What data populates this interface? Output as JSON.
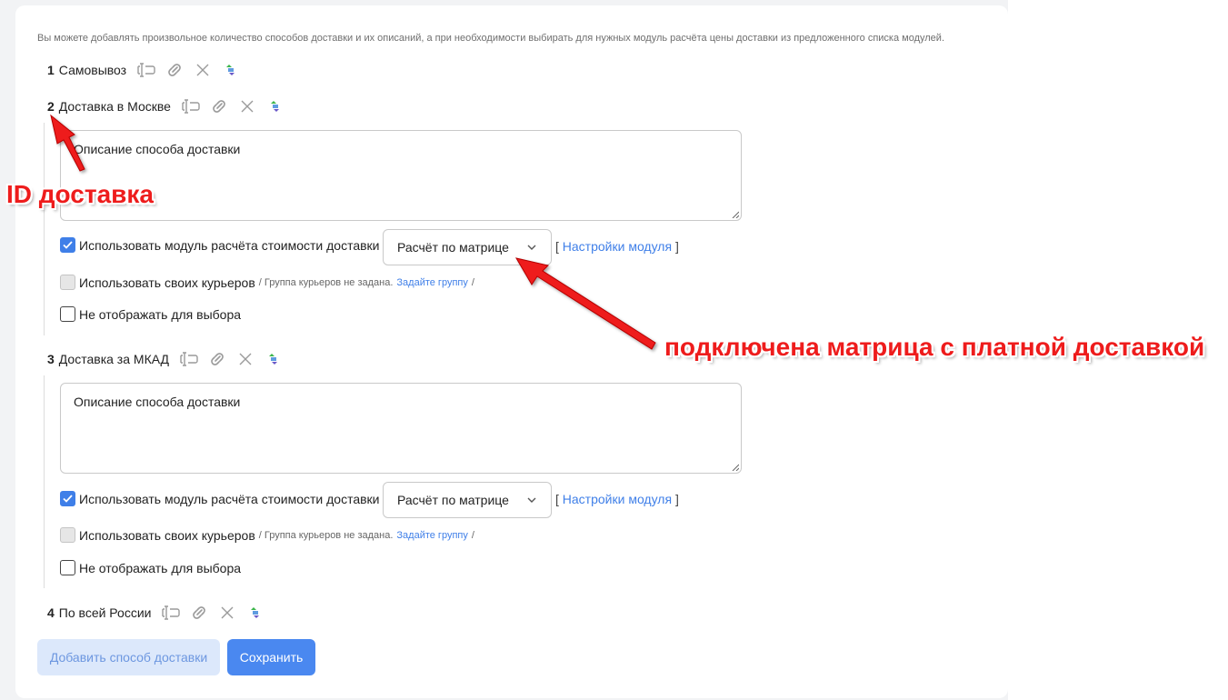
{
  "intro": "Вы можете добавлять произвольное количество способов доставки и их описаний, а при необходимости выбирать для нужных модуль расчёта цены доставки из предложенного списка модулей.",
  "methods": [
    {
      "num": "1",
      "title": "Самовывоз"
    },
    {
      "num": "2",
      "title": "Доставка в Москве",
      "description": "Описание способа доставки",
      "use_module_label": "Использовать модуль расчёта стоимости доставки",
      "use_module_checked": true,
      "module_selected": "Расчёт по матрице",
      "module_settings_open": "[",
      "module_settings_link": "Настройки модуля",
      "module_settings_close": "]",
      "couriers_label": "Использовать своих курьеров",
      "couriers_note": "/ Группа курьеров не задана.",
      "couriers_link": "Задайте группу",
      "couriers_note_end": "/",
      "hide_label": "Не отображать для выбора"
    },
    {
      "num": "3",
      "title": "Доставка за МКАД",
      "description": "Описание способа доставки",
      "use_module_label": "Использовать модуль расчёта стоимости доставки",
      "use_module_checked": true,
      "module_selected": "Расчёт по матрице",
      "module_settings_open": "[",
      "module_settings_link": "Настройки модуля",
      "module_settings_close": "]",
      "couriers_label": "Использовать своих курьеров",
      "couriers_note": "/ Группа курьеров не задана.",
      "couriers_link": "Задайте группу",
      "couriers_note_end": "/",
      "hide_label": "Не отображать для выбора"
    },
    {
      "num": "4",
      "title": "По всей России"
    }
  ],
  "row_icons": [
    "rename-icon",
    "link-icon",
    "delete-icon",
    "sort-icon"
  ],
  "buttons": {
    "add": "Добавить способ доставки",
    "save": "Сохранить"
  },
  "annotations": {
    "id": "ID доставка",
    "matrix": "подключена матрица с платной доставкой"
  },
  "colors": {
    "accent": "#3f7fe8",
    "annotation": "#ee1c1c"
  }
}
